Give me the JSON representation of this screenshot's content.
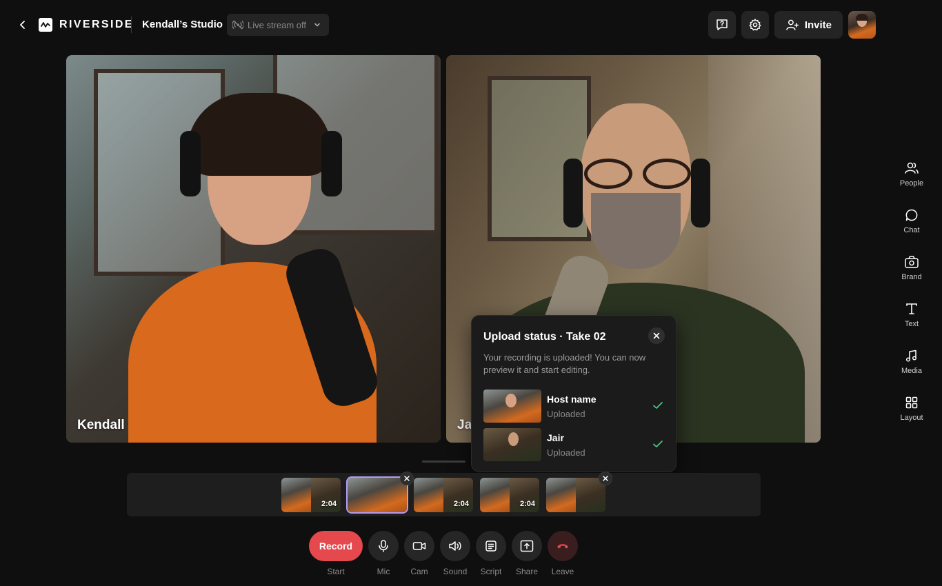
{
  "header": {
    "brand": "RIVERSIDE",
    "studio_name": "Kendall’s Studio",
    "live_stream": "Live stream off",
    "invite_label": "Invite"
  },
  "participants": [
    {
      "name": "Kendall"
    },
    {
      "name": "Ja"
    }
  ],
  "upload_panel": {
    "title": "Upload status · Take 02",
    "description": "Your recording is uploaded! You can now preview it and start editing.",
    "items": [
      {
        "name": "Host name",
        "status": "Uploaded"
      },
      {
        "name": "Jair",
        "status": "Uploaded"
      }
    ]
  },
  "takes": [
    {
      "duration": "2:04"
    },
    {
      "duration": ""
    },
    {
      "duration": "2:04"
    },
    {
      "duration": "2:04"
    },
    {
      "duration": ""
    }
  ],
  "controls": {
    "record_label": "Record",
    "labels": {
      "start": "Start",
      "mic": "Mic",
      "cam": "Cam",
      "sound": "Sound",
      "script": "Script",
      "share": "Share",
      "leave": "Leave"
    }
  },
  "sidebar": {
    "items": [
      {
        "label": "People"
      },
      {
        "label": "Chat"
      },
      {
        "label": "Brand"
      },
      {
        "label": "Text"
      },
      {
        "label": "Media"
      },
      {
        "label": "Layout"
      }
    ]
  },
  "colors": {
    "record": "#e5484d",
    "selected_take": "#b39cf2",
    "check": "#4cc38a"
  }
}
